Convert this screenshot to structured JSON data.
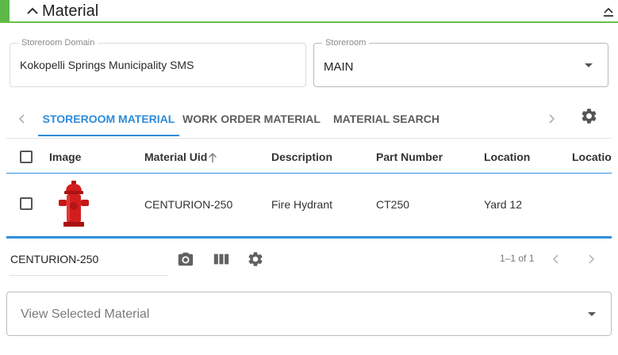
{
  "section": {
    "title": "Material"
  },
  "fields": {
    "storeroom_domain": {
      "label": "Storeroom Domain",
      "value": "Kokopelli Springs Municipality SMS"
    },
    "storeroom": {
      "label": "Storeroom",
      "value": "MAIN"
    }
  },
  "tabs": [
    {
      "label": "STOREROOM MATERIAL",
      "active": true
    },
    {
      "label": "WORK ORDER MATERIAL",
      "active": false
    },
    {
      "label": "MATERIAL SEARCH",
      "active": false
    }
  ],
  "table": {
    "columns": [
      "Image",
      "Material Uid",
      "Description",
      "Part Number",
      "Location",
      "Location"
    ],
    "sort_column": "Material Uid",
    "rows": [
      {
        "material_uid": "CENTURION-250",
        "description": "Fire Hydrant",
        "part_number": "CT250",
        "location": "Yard 12",
        "image_icon": "fire-hydrant"
      }
    ]
  },
  "footer": {
    "selected_value": "CENTURION-250",
    "pager_text": "1–1 of 1"
  },
  "view_select": {
    "placeholder": "View Selected Material"
  },
  "colors": {
    "accent_green": "#5cb947",
    "accent_blue": "#2e8bd9",
    "hydrant_red": "#d21d1d"
  }
}
